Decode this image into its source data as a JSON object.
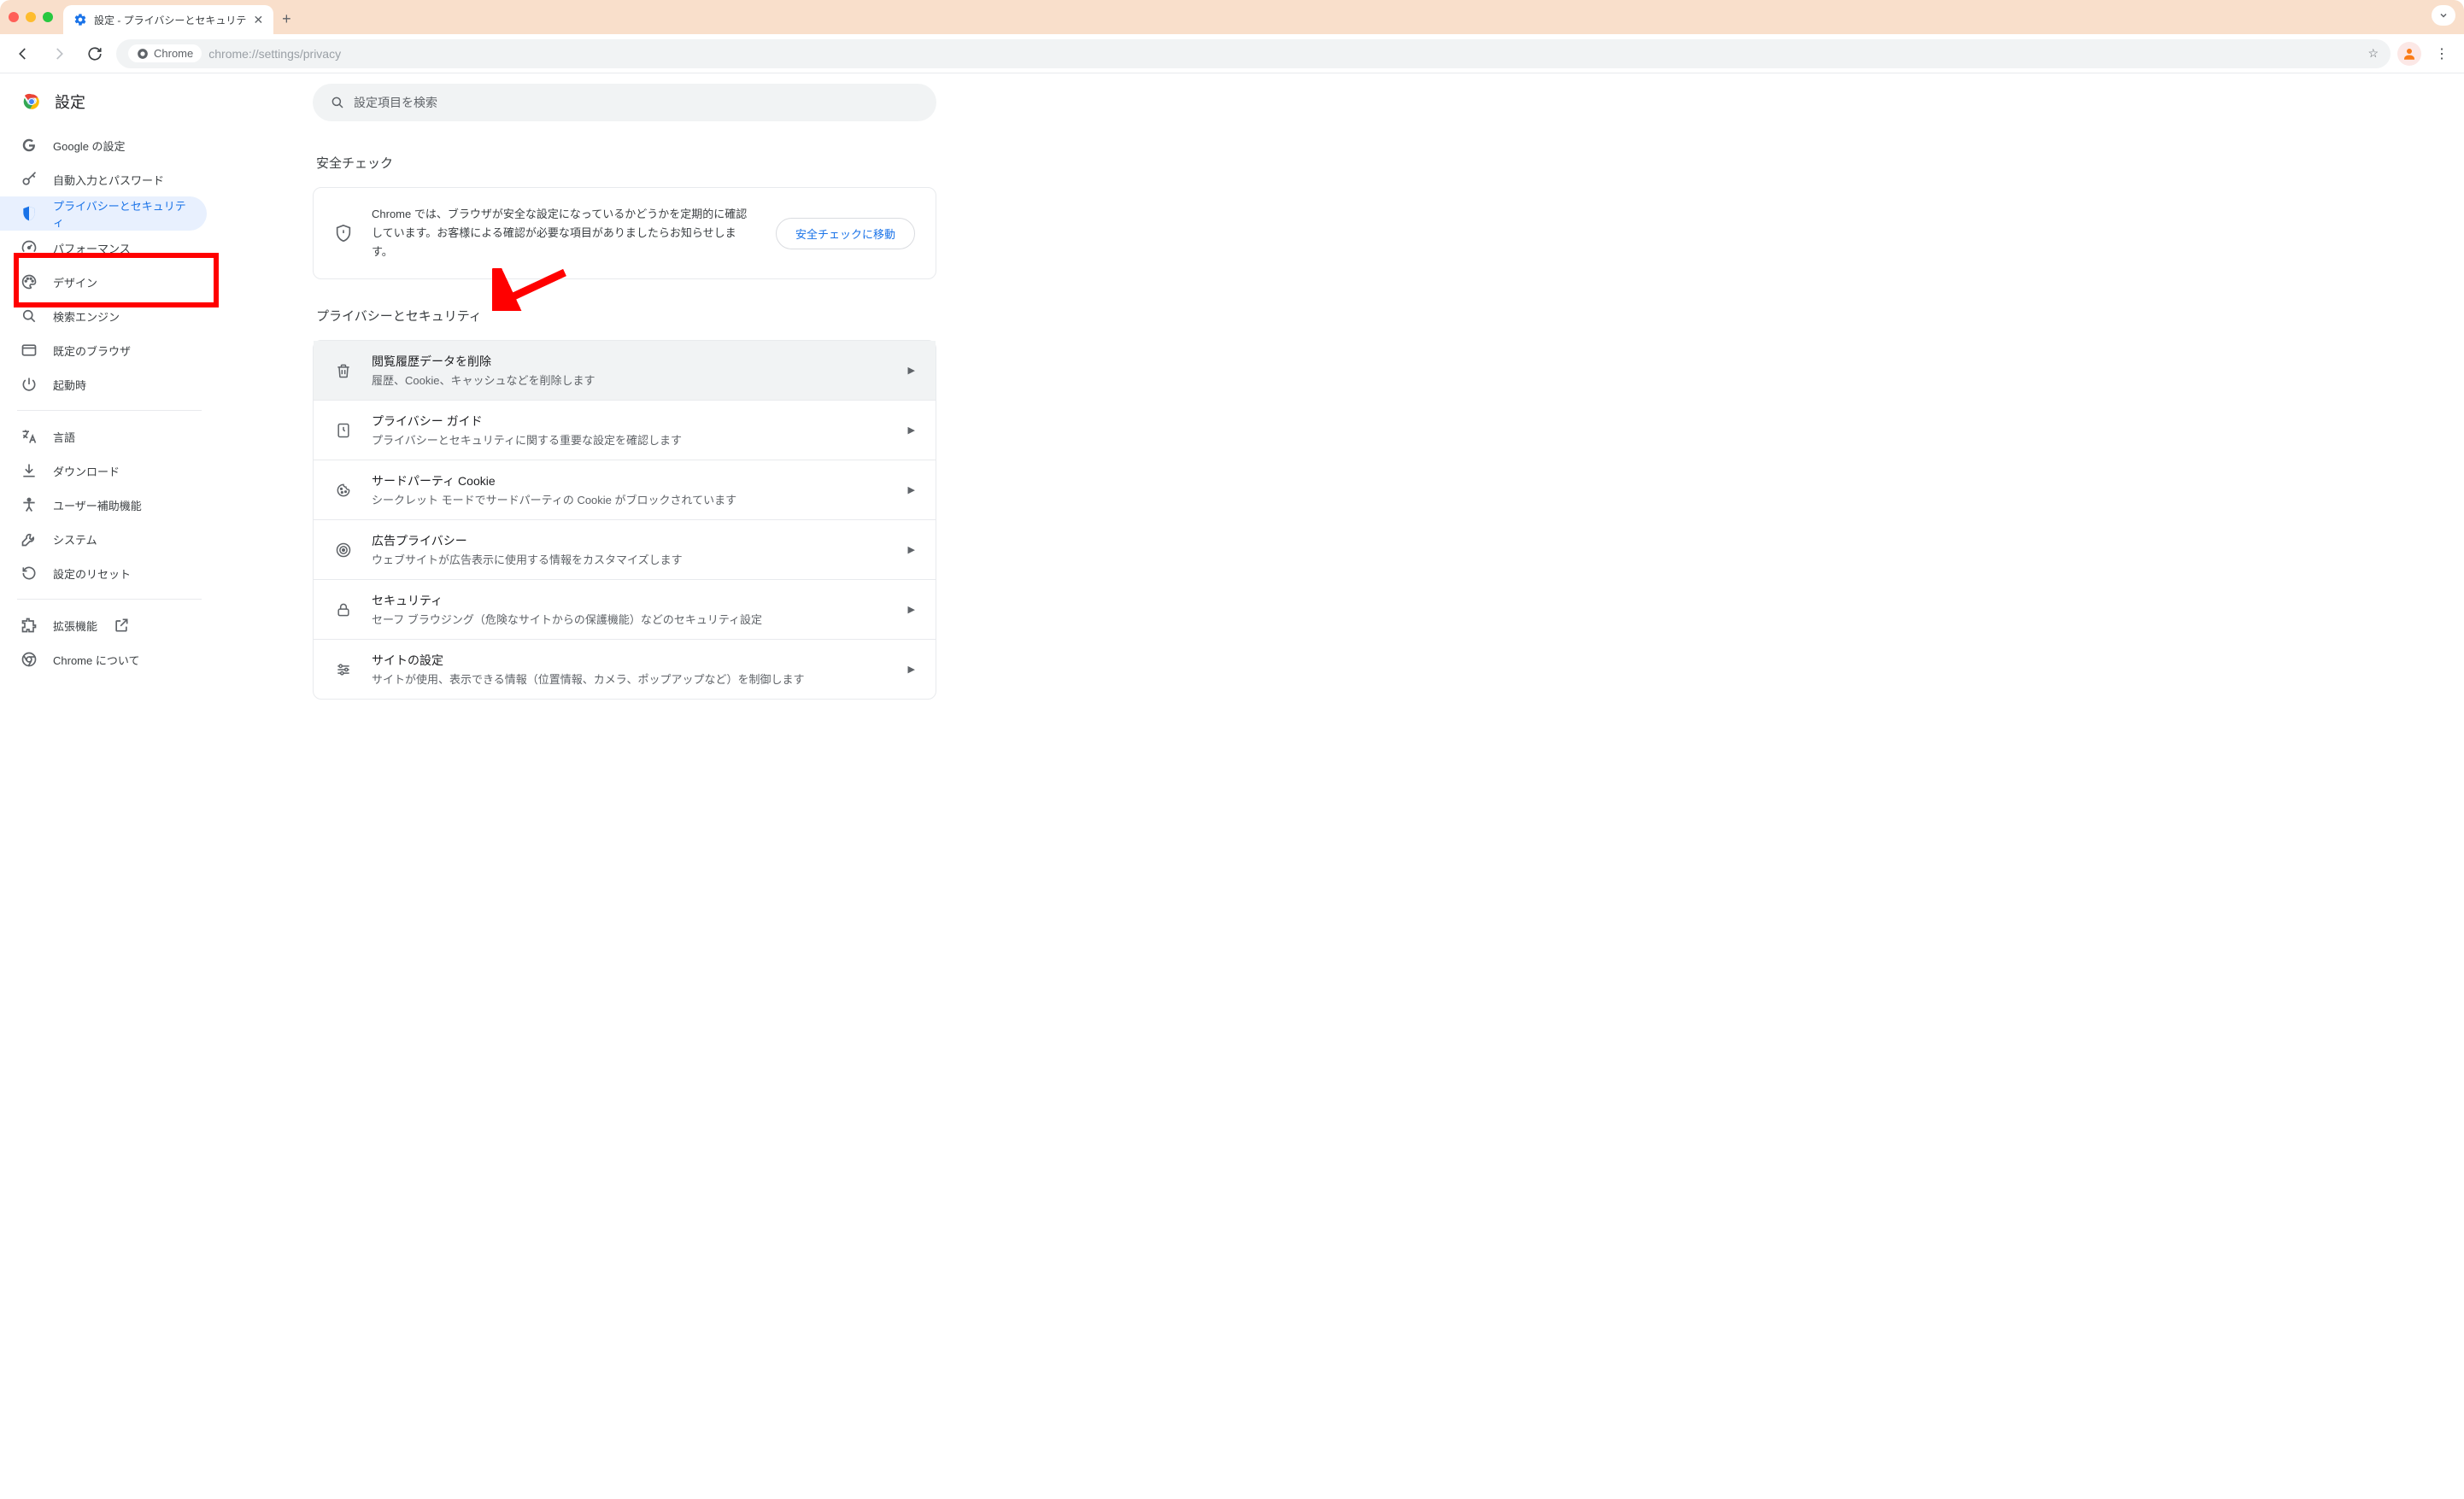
{
  "window": {
    "tab_title": "設定 - プライバシーとセキュリテ"
  },
  "toolbar": {
    "chip_label": "Chrome",
    "url": "chrome://settings/privacy"
  },
  "sidebar": {
    "title": "設定",
    "items": [
      {
        "label": "Google の設定"
      },
      {
        "label": "自動入力とパスワード"
      },
      {
        "label": "プライバシーとセキュリティ"
      },
      {
        "label": "パフォーマンス"
      },
      {
        "label": "デザイン"
      },
      {
        "label": "検索エンジン"
      },
      {
        "label": "既定のブラウザ"
      },
      {
        "label": "起動時"
      }
    ],
    "items2": [
      {
        "label": "言語"
      },
      {
        "label": "ダウンロード"
      },
      {
        "label": "ユーザー補助機能"
      },
      {
        "label": "システム"
      },
      {
        "label": "設定のリセット"
      }
    ],
    "items3": [
      {
        "label": "拡張機能"
      },
      {
        "label": "Chrome について"
      }
    ]
  },
  "main": {
    "search_placeholder": "設定項目を検索",
    "safety": {
      "heading": "安全チェック",
      "desc": "Chrome では、ブラウザが安全な設定になっているかどうかを定期的に確認しています。お客様による確認が必要な項目がありましたらお知らせします。",
      "button": "安全チェックに移動"
    },
    "privacy": {
      "heading": "プライバシーとセキュリティ",
      "items": [
        {
          "title": "閲覧履歴データを削除",
          "sub": "履歴、Cookie、キャッシュなどを削除します"
        },
        {
          "title": "プライバシー ガイド",
          "sub": "プライバシーとセキュリティに関する重要な設定を確認します"
        },
        {
          "title": "サードパーティ Cookie",
          "sub": "シークレット モードでサードパーティの Cookie がブロックされています"
        },
        {
          "title": "広告プライバシー",
          "sub": "ウェブサイトが広告表示に使用する情報をカスタマイズします"
        },
        {
          "title": "セキュリティ",
          "sub": "セーフ ブラウジング（危険なサイトからの保護機能）などのセキュリティ設定"
        },
        {
          "title": "サイトの設定",
          "sub": "サイトが使用、表示できる情報（位置情報、カメラ、ポップアップなど）を制御します"
        }
      ]
    }
  }
}
